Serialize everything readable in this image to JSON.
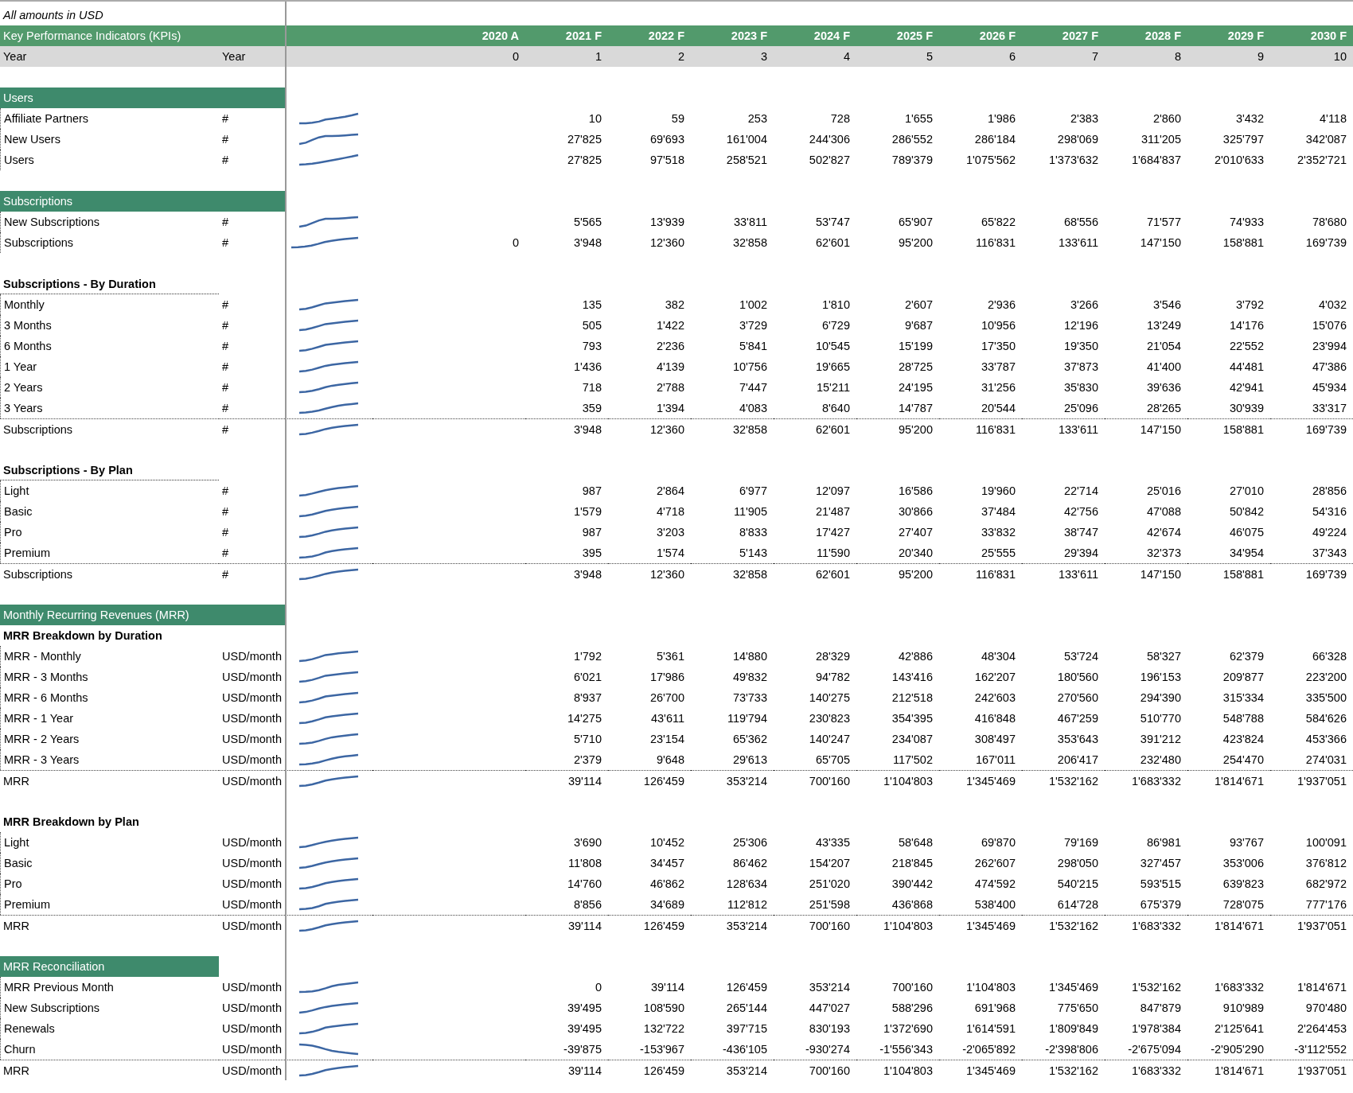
{
  "note": "All amounts in USD",
  "header": {
    "title": "Key Performance Indicators (KPIs)",
    "columns": [
      "2020 A",
      "2021 F",
      "2022 F",
      "2023 F",
      "2024 F",
      "2025 F",
      "2026 F",
      "2027 F",
      "2028 F",
      "2029 F",
      "2030 F"
    ]
  },
  "year_row": {
    "label": "Year",
    "unit": "Year",
    "values": [
      "0",
      "1",
      "2",
      "3",
      "4",
      "5",
      "6",
      "7",
      "8",
      "9",
      "10"
    ]
  },
  "rows": [
    {
      "kind": "blank"
    },
    {
      "kind": "section",
      "label": "Users"
    },
    {
      "kind": "data",
      "label": "Affiliate Partners",
      "unit": "#",
      "values": [
        "10",
        "59",
        "253",
        "728",
        "1'655",
        "1'986",
        "2'383",
        "2'860",
        "3'432",
        "4'118"
      ]
    },
    {
      "kind": "data",
      "label": "New Users",
      "unit": "#",
      "values": [
        "27'825",
        "69'693",
        "161'004",
        "244'306",
        "286'552",
        "286'184",
        "298'069",
        "311'205",
        "325'797",
        "342'087"
      ]
    },
    {
      "kind": "data",
      "label": "Users",
      "unit": "#",
      "values": [
        "27'825",
        "97'518",
        "258'521",
        "502'827",
        "789'379",
        "1'075'562",
        "1'373'632",
        "1'684'837",
        "2'010'633",
        "2'352'721"
      ]
    },
    {
      "kind": "blank"
    },
    {
      "kind": "section",
      "label": "Subscriptions"
    },
    {
      "kind": "data",
      "label": "New Subscriptions",
      "unit": "#",
      "values": [
        "5'565",
        "13'939",
        "33'811",
        "53'747",
        "65'907",
        "65'822",
        "68'556",
        "71'577",
        "74'933",
        "78'680"
      ]
    },
    {
      "kind": "data",
      "label": "Subscriptions",
      "unit": "#",
      "actual": "0",
      "values": [
        "3'948",
        "12'360",
        "32'858",
        "62'601",
        "95'200",
        "116'831",
        "133'611",
        "147'150",
        "158'881",
        "169'739"
      ]
    },
    {
      "kind": "blank"
    },
    {
      "kind": "subheader",
      "label": "Subscriptions - By Duration"
    },
    {
      "kind": "data",
      "label": "Monthly",
      "unit": "#",
      "values": [
        "135",
        "382",
        "1'002",
        "1'810",
        "2'607",
        "2'936",
        "3'266",
        "3'546",
        "3'792",
        "4'032"
      ]
    },
    {
      "kind": "data",
      "label": "3 Months",
      "unit": "#",
      "values": [
        "505",
        "1'422",
        "3'729",
        "6'729",
        "9'687",
        "10'956",
        "12'196",
        "13'249",
        "14'176",
        "15'076"
      ]
    },
    {
      "kind": "data",
      "label": "6 Months",
      "unit": "#",
      "values": [
        "793",
        "2'236",
        "5'841",
        "10'545",
        "15'199",
        "17'350",
        "19'350",
        "21'054",
        "22'552",
        "23'994"
      ]
    },
    {
      "kind": "data",
      "label": "1 Year",
      "unit": "#",
      "values": [
        "1'436",
        "4'139",
        "10'756",
        "19'665",
        "28'725",
        "33'787",
        "37'873",
        "41'400",
        "44'481",
        "47'386"
      ]
    },
    {
      "kind": "data",
      "label": "2 Years",
      "unit": "#",
      "values": [
        "718",
        "2'788",
        "7'447",
        "15'211",
        "24'195",
        "31'256",
        "35'830",
        "39'636",
        "42'941",
        "45'934"
      ]
    },
    {
      "kind": "data",
      "label": "3 Years",
      "unit": "#",
      "values": [
        "359",
        "1'394",
        "4'083",
        "8'640",
        "14'787",
        "20'544",
        "25'096",
        "28'265",
        "30'939",
        "33'317"
      ]
    },
    {
      "kind": "total",
      "label": "Subscriptions",
      "unit": "#",
      "values": [
        "3'948",
        "12'360",
        "32'858",
        "62'601",
        "95'200",
        "116'831",
        "133'611",
        "147'150",
        "158'881",
        "169'739"
      ]
    },
    {
      "kind": "blank"
    },
    {
      "kind": "subheader",
      "label": "Subscriptions - By Plan"
    },
    {
      "kind": "data",
      "label": "Light",
      "unit": "#",
      "values": [
        "987",
        "2'864",
        "6'977",
        "12'097",
        "16'586",
        "19'960",
        "22'714",
        "25'016",
        "27'010",
        "28'856"
      ]
    },
    {
      "kind": "data",
      "label": "Basic",
      "unit": "#",
      "values": [
        "1'579",
        "4'718",
        "11'905",
        "21'487",
        "30'866",
        "37'484",
        "42'756",
        "47'088",
        "50'842",
        "54'316"
      ]
    },
    {
      "kind": "data",
      "label": "Pro",
      "unit": "#",
      "values": [
        "987",
        "3'203",
        "8'833",
        "17'427",
        "27'407",
        "33'832",
        "38'747",
        "42'674",
        "46'075",
        "49'224"
      ]
    },
    {
      "kind": "data",
      "label": "Premium",
      "unit": "#",
      "values": [
        "395",
        "1'574",
        "5'143",
        "11'590",
        "20'340",
        "25'555",
        "29'394",
        "32'373",
        "34'954",
        "37'343"
      ]
    },
    {
      "kind": "total",
      "label": "Subscriptions",
      "unit": "#",
      "values": [
        "3'948",
        "12'360",
        "32'858",
        "62'601",
        "95'200",
        "116'831",
        "133'611",
        "147'150",
        "158'881",
        "169'739"
      ]
    },
    {
      "kind": "blank"
    },
    {
      "kind": "section",
      "label": "Monthly Recurring Revenues (MRR)"
    },
    {
      "kind": "group",
      "label": "MRR Breakdown by Duration"
    },
    {
      "kind": "data",
      "label": "MRR - Monthly",
      "unit": "USD/month",
      "values": [
        "1'792",
        "5'361",
        "14'880",
        "28'329",
        "42'886",
        "48'304",
        "53'724",
        "58'327",
        "62'379",
        "66'328"
      ]
    },
    {
      "kind": "data",
      "label": "MRR - 3 Months",
      "unit": "USD/month",
      "values": [
        "6'021",
        "17'986",
        "49'832",
        "94'782",
        "143'416",
        "162'207",
        "180'560",
        "196'153",
        "209'877",
        "223'200"
      ]
    },
    {
      "kind": "data",
      "label": "MRR - 6 Months",
      "unit": "USD/month",
      "values": [
        "8'937",
        "26'700",
        "73'733",
        "140'275",
        "212'518",
        "242'603",
        "270'560",
        "294'390",
        "315'334",
        "335'500"
      ]
    },
    {
      "kind": "data",
      "label": "MRR - 1 Year",
      "unit": "USD/month",
      "values": [
        "14'275",
        "43'611",
        "119'794",
        "230'823",
        "354'395",
        "416'848",
        "467'259",
        "510'770",
        "548'788",
        "584'626"
      ]
    },
    {
      "kind": "data",
      "label": "MRR - 2 Years",
      "unit": "USD/month",
      "values": [
        "5'710",
        "23'154",
        "65'362",
        "140'247",
        "234'087",
        "308'497",
        "353'643",
        "391'212",
        "423'824",
        "453'366"
      ]
    },
    {
      "kind": "data",
      "label": "MRR - 3 Years",
      "unit": "USD/month",
      "values": [
        "2'379",
        "9'648",
        "29'613",
        "65'705",
        "117'502",
        "167'011",
        "206'417",
        "232'480",
        "254'470",
        "274'031"
      ]
    },
    {
      "kind": "total",
      "label": "MRR",
      "unit": "USD/month",
      "values": [
        "39'114",
        "126'459",
        "353'214",
        "700'160",
        "1'104'803",
        "1'345'469",
        "1'532'162",
        "1'683'332",
        "1'814'671",
        "1'937'051"
      ]
    },
    {
      "kind": "blank"
    },
    {
      "kind": "group",
      "label": "MRR Breakdown by Plan"
    },
    {
      "kind": "data",
      "label": "Light",
      "unit": "USD/month",
      "values": [
        "3'690",
        "10'452",
        "25'306",
        "43'335",
        "58'648",
        "69'870",
        "79'169",
        "86'981",
        "93'767",
        "100'091"
      ]
    },
    {
      "kind": "data",
      "label": "Basic",
      "unit": "USD/month",
      "values": [
        "11'808",
        "34'457",
        "86'462",
        "154'207",
        "218'845",
        "262'607",
        "298'050",
        "327'457",
        "353'006",
        "376'812"
      ]
    },
    {
      "kind": "data",
      "label": "Pro",
      "unit": "USD/month",
      "values": [
        "14'760",
        "46'862",
        "128'634",
        "251'020",
        "390'442",
        "474'592",
        "540'215",
        "593'515",
        "639'823",
        "682'972"
      ]
    },
    {
      "kind": "data",
      "label": "Premium",
      "unit": "USD/month",
      "values": [
        "8'856",
        "34'689",
        "112'812",
        "251'598",
        "436'868",
        "538'400",
        "614'728",
        "675'379",
        "728'075",
        "777'176"
      ]
    },
    {
      "kind": "total",
      "label": "MRR",
      "unit": "USD/month",
      "values": [
        "39'114",
        "126'459",
        "353'214",
        "700'160",
        "1'104'803",
        "1'345'469",
        "1'532'162",
        "1'683'332",
        "1'814'671",
        "1'937'051"
      ]
    },
    {
      "kind": "blank"
    },
    {
      "kind": "heading",
      "label": "MRR Reconciliation"
    },
    {
      "kind": "data",
      "label": "MRR Previous Month",
      "unit": "USD/month",
      "values": [
        "0",
        "39'114",
        "126'459",
        "353'214",
        "700'160",
        "1'104'803",
        "1'345'469",
        "1'532'162",
        "1'683'332",
        "1'814'671"
      ]
    },
    {
      "kind": "data",
      "label": "New Subscriptions",
      "unit": "USD/month",
      "values": [
        "39'495",
        "108'590",
        "265'144",
        "447'027",
        "588'296",
        "691'968",
        "775'650",
        "847'879",
        "910'989",
        "970'480"
      ]
    },
    {
      "kind": "data",
      "label": "Renewals",
      "unit": "USD/month",
      "values": [
        "39'495",
        "132'722",
        "397'715",
        "830'193",
        "1'372'690",
        "1'614'591",
        "1'809'849",
        "1'978'384",
        "2'125'641",
        "2'264'453"
      ]
    },
    {
      "kind": "data",
      "label": "Churn",
      "unit": "USD/month",
      "values": [
        "-39'875",
        "-153'967",
        "-436'105",
        "-930'274",
        "-1'556'343",
        "-2'065'892",
        "-2'398'806",
        "-2'675'094",
        "-2'905'290",
        "-3'112'552"
      ]
    },
    {
      "kind": "total",
      "label": "MRR",
      "unit": "USD/month",
      "values": [
        "39'114",
        "126'459",
        "353'214",
        "700'160",
        "1'104'803",
        "1'345'469",
        "1'532'162",
        "1'683'332",
        "1'814'671",
        "1'937'051"
      ]
    }
  ]
}
